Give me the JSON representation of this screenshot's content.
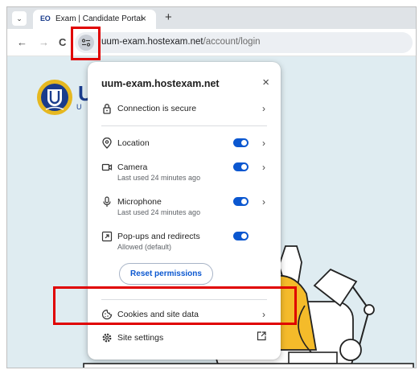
{
  "browser": {
    "tab": {
      "favicon_text": "EO",
      "title": "Exam | Candidate Portal",
      "close": "×"
    },
    "tab_dropdown": "⌄",
    "new_tab": "+",
    "nav": {
      "back": "←",
      "forward": "→",
      "reload": "C"
    },
    "url": {
      "host": "uum-exam.hostexam.net",
      "path": "/account/login"
    }
  },
  "page": {
    "logo_letter": "U",
    "logo_small": "U"
  },
  "popup": {
    "title": "uum-exam.hostexam.net",
    "close": "×",
    "connection": {
      "label": "Connection is secure"
    },
    "permissions": [
      {
        "label": "Location",
        "sub": "",
        "toggle_on": true,
        "has_chevron": true,
        "icon": "location-pin-icon"
      },
      {
        "label": "Camera",
        "sub": "Last used 24 minutes ago",
        "toggle_on": true,
        "has_chevron": true,
        "icon": "camera-icon"
      },
      {
        "label": "Microphone",
        "sub": "Last used 24 minutes ago",
        "toggle_on": true,
        "has_chevron": true,
        "icon": "microphone-icon"
      },
      {
        "label": "Pop-ups and redirects",
        "sub": "Allowed (default)",
        "toggle_on": true,
        "has_chevron": false,
        "icon": "popup-redirect-icon"
      }
    ],
    "reset_label": "Reset permissions",
    "cookies": {
      "label": "Cookies and site data"
    },
    "site_settings": {
      "label": "Site settings"
    },
    "chevron": "›"
  },
  "colors": {
    "accent": "#0b57d0",
    "highlight": "#e00000",
    "page_background": "#dfecf1"
  }
}
